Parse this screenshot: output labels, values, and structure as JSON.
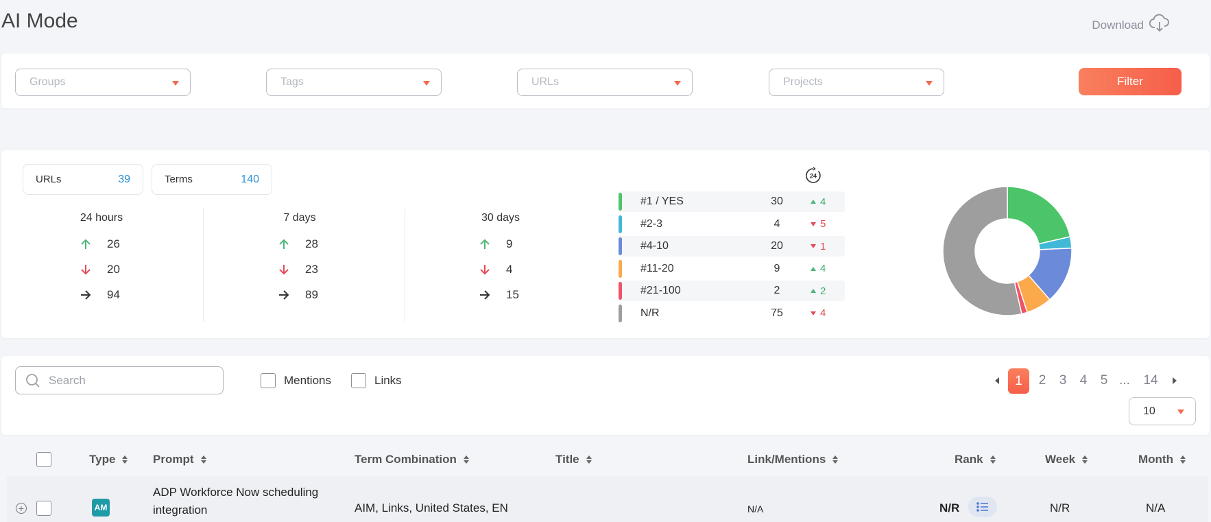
{
  "page": {
    "title": "AI Mode",
    "download_label": "Download"
  },
  "filters": {
    "groups_placeholder": "Groups",
    "tags_placeholder": "Tags",
    "urls_placeholder": "URLs",
    "projects_placeholder": "Projects",
    "filter_label": "Filter"
  },
  "summary": {
    "urls_label": "URLs",
    "urls_count": "39",
    "terms_label": "Terms",
    "terms_count": "140"
  },
  "periods": [
    {
      "label": "24 hours",
      "up": "26",
      "down": "20",
      "flat": "94"
    },
    {
      "label": "7 days",
      "up": "28",
      "down": "23",
      "flat": "89"
    },
    {
      "label": "30 days",
      "up": "9",
      "down": "4",
      "flat": "15"
    }
  ],
  "ranks": [
    {
      "label": "#1 / YES",
      "value": "30",
      "change": "4",
      "dir": "up",
      "color": "#4cc46a"
    },
    {
      "label": "#2-3",
      "value": "4",
      "change": "5",
      "dir": "down",
      "color": "#41b9d6"
    },
    {
      "label": "#4-10",
      "value": "20",
      "change": "1",
      "dir": "down",
      "color": "#6b8ad9"
    },
    {
      "label": "#11-20",
      "value": "9",
      "change": "4",
      "dir": "up",
      "color": "#fba94a"
    },
    {
      "label": "#21-100",
      "value": "2",
      "change": "2",
      "dir": "up",
      "color": "#f05366"
    },
    {
      "label": "N/R",
      "value": "75",
      "change": "4",
      "dir": "down",
      "color": "#9e9e9e"
    }
  ],
  "chart_data": {
    "type": "pie",
    "style": "donut",
    "categories": [
      "#1 / YES",
      "#2-3",
      "#4-10",
      "#11-20",
      "#21-100",
      "N/R"
    ],
    "values": [
      30,
      4,
      20,
      9,
      2,
      75
    ],
    "colors": [
      "#4cc46a",
      "#41b9d6",
      "#6b8ad9",
      "#fba94a",
      "#f05366",
      "#9e9e9e"
    ]
  },
  "toolbar": {
    "search_placeholder": "Search",
    "mentions_label": "Mentions",
    "links_label": "Links",
    "pages": [
      "1",
      "2",
      "3",
      "4",
      "5",
      "...",
      "14"
    ],
    "current_page": "1",
    "per_page": "10"
  },
  "table": {
    "headers": {
      "type": "Type",
      "prompt": "Prompt",
      "term": "Term Combination",
      "title": "Title",
      "links": "Link/Mentions",
      "rank": "Rank",
      "week": "Week",
      "month": "Month"
    },
    "rows": [
      {
        "type_badge": "AM",
        "prompt_line1": "ADP Workforce Now scheduling",
        "prompt_line2": "integration",
        "term": "AIM, Links, United States, EN",
        "title": "",
        "links": "N/A",
        "rank": "N/R",
        "week": "N/R",
        "month": "N/A"
      }
    ]
  }
}
